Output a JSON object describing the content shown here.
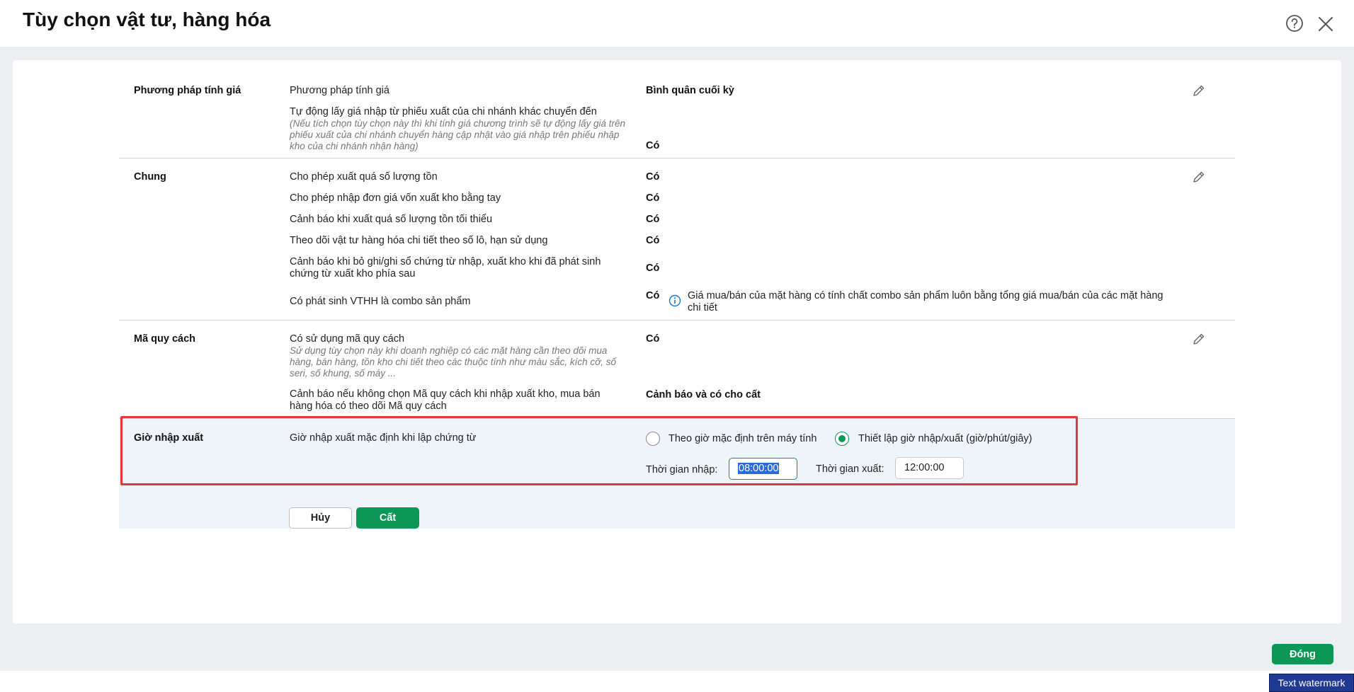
{
  "dialog": {
    "title": "Tùy chọn vật tư, hàng hóa"
  },
  "sections": {
    "pricing": {
      "title": "Phương pháp tính giá",
      "row1": {
        "label": "Phương pháp tính giá",
        "value": "Bình quân cuối kỳ"
      },
      "row2": {
        "label": "Tự động lấy giá nhập từ phiếu xuất của chi nhánh khác chuyển đến",
        "hint": "(Nếu tích chọn tùy chọn này thì khi tính giá chương trình sẽ tự động lấy giá trên phiếu xuất của chi nhánh chuyển hàng cập nhật vào giá nhập trên phiếu nhập kho của chi nhánh nhận hàng)",
        "value": "Có"
      }
    },
    "general": {
      "title": "Chung",
      "rows": [
        {
          "label": "Cho phép xuất quá số lượng tồn",
          "value": "Có"
        },
        {
          "label": "Cho phép nhập đơn giá vốn xuất kho bằng tay",
          "value": "Có"
        },
        {
          "label": "Cảnh báo khi xuất quá số lượng tồn tối thiểu",
          "value": "Có"
        },
        {
          "label": "Theo dõi vật tư hàng hóa chi tiết theo số lô, hạn sử dụng",
          "value": "Có"
        },
        {
          "label": "Cảnh báo khi bỏ ghi/ghi sổ chứng từ nhập, xuất kho khi đã phát sinh chứng từ xuất kho phía sau",
          "value": "Có"
        },
        {
          "label": "Có phát sinh VTHH là combo sản phẩm",
          "value": "Có",
          "note": "Giá mua/bán của mặt hàng có tính chất combo sản phẩm luôn bằng tổng giá mua/bán của các mặt hàng chi tiết"
        }
      ]
    },
    "spec": {
      "title": "Mã quy cách",
      "row1": {
        "label": "Có sử dụng mã quy cách",
        "hint": "Sử dụng tùy chọn này khi doanh nghiệp có các mặt hàng cần theo dõi mua hàng, bán hàng, tồn kho chi tiết theo các thuộc tính như màu sắc, kích cỡ, số seri, số khung, số máy ...",
        "value": "Có"
      },
      "row2": {
        "label": "Cảnh báo nếu không chọn Mã quy cách khi nhập xuất kho, mua bán hàng hóa có theo dõi Mã quy cách",
        "value": "Cảnh báo và có cho cất"
      }
    },
    "io_time": {
      "title": "Giờ nhập xuất",
      "label": "Giờ nhập xuất mặc định khi lập chứng từ",
      "option1": "Theo giờ mặc định trên máy tính",
      "option2": "Thiết lập giờ nhập/xuất (giờ/phút/giây)",
      "selected_option": 2,
      "import_label": "Thời gian nhập:",
      "import_value": "08:00:00",
      "export_label": "Thời gian xuất:",
      "export_value": "12:00:00"
    }
  },
  "buttons": {
    "cancel": "Hủy",
    "save": "Cất",
    "close": "Đóng"
  },
  "watermark": "Text watermark",
  "colors": {
    "accent": "#0d9757",
    "highlight_border": "#e0383e",
    "info": "#1a73c7"
  }
}
